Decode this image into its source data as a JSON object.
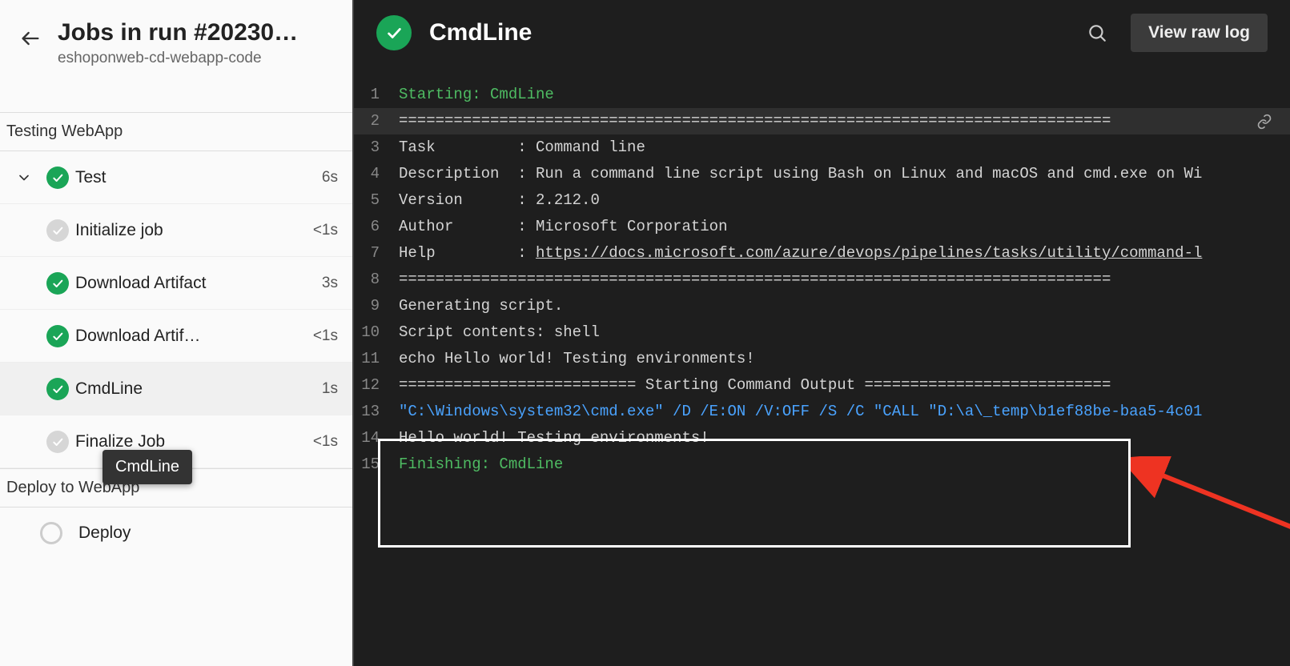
{
  "left": {
    "title": "Jobs in run #20230…",
    "subtitle": "eshoponweb-cd-webapp-code",
    "stage1": "Testing WebApp",
    "stage2": "Deploy to WebApp",
    "job1": {
      "label": "Test",
      "time": "6s"
    },
    "steps": [
      {
        "label": "Initialize job",
        "time": "<1s",
        "status": "pending"
      },
      {
        "label": "Download Artifact",
        "time": "3s",
        "status": "success"
      },
      {
        "label": "Download Artif…",
        "time": "<1s",
        "status": "success"
      },
      {
        "label": "CmdLine",
        "time": "1s",
        "status": "success",
        "selected": true
      },
      {
        "label": "Finalize Job",
        "time": "<1s",
        "status": "pending"
      }
    ],
    "tooltip": "CmdLine",
    "deploy_label": "Deploy"
  },
  "header": {
    "task_title": "CmdLine",
    "raw_log_label": "View raw log"
  },
  "log": {
    "lines": [
      {
        "n": 1,
        "type": "green",
        "text": "Starting: CmdLine"
      },
      {
        "n": 2,
        "type": "plain",
        "text": "==============================================================================",
        "hover": true,
        "linkicon": true
      },
      {
        "n": 3,
        "type": "plain",
        "text": "Task         : Command line"
      },
      {
        "n": 4,
        "type": "plain",
        "text": "Description  : Run a command line script using Bash on Linux and macOS and cmd.exe on Wi"
      },
      {
        "n": 5,
        "type": "plain",
        "text": "Version      : 2.212.0"
      },
      {
        "n": 6,
        "type": "plain",
        "text": "Author       : Microsoft Corporation"
      },
      {
        "n": 7,
        "type": "link",
        "prefix": "Help         : ",
        "text": "https://docs.microsoft.com/azure/devops/pipelines/tasks/utility/command-l"
      },
      {
        "n": 8,
        "type": "plain",
        "text": "=============================================================================="
      },
      {
        "n": 9,
        "type": "plain",
        "text": "Generating script."
      },
      {
        "n": 10,
        "type": "plain",
        "text": "Script contents: shell"
      },
      {
        "n": 11,
        "type": "plain",
        "text": "echo Hello world! Testing environments!"
      },
      {
        "n": 12,
        "type": "plain",
        "text": "========================== Starting Command Output ==========================="
      },
      {
        "n": 13,
        "type": "blue",
        "text": "\"C:\\Windows\\system32\\cmd.exe\" /D /E:ON /V:OFF /S /C \"CALL \"D:\\a\\_temp\\b1ef88be-baa5-4c01"
      },
      {
        "n": 14,
        "type": "plain",
        "text": "Hello world! Testing environments!"
      },
      {
        "n": 15,
        "type": "green",
        "text": "Finishing: CmdLine"
      }
    ]
  }
}
